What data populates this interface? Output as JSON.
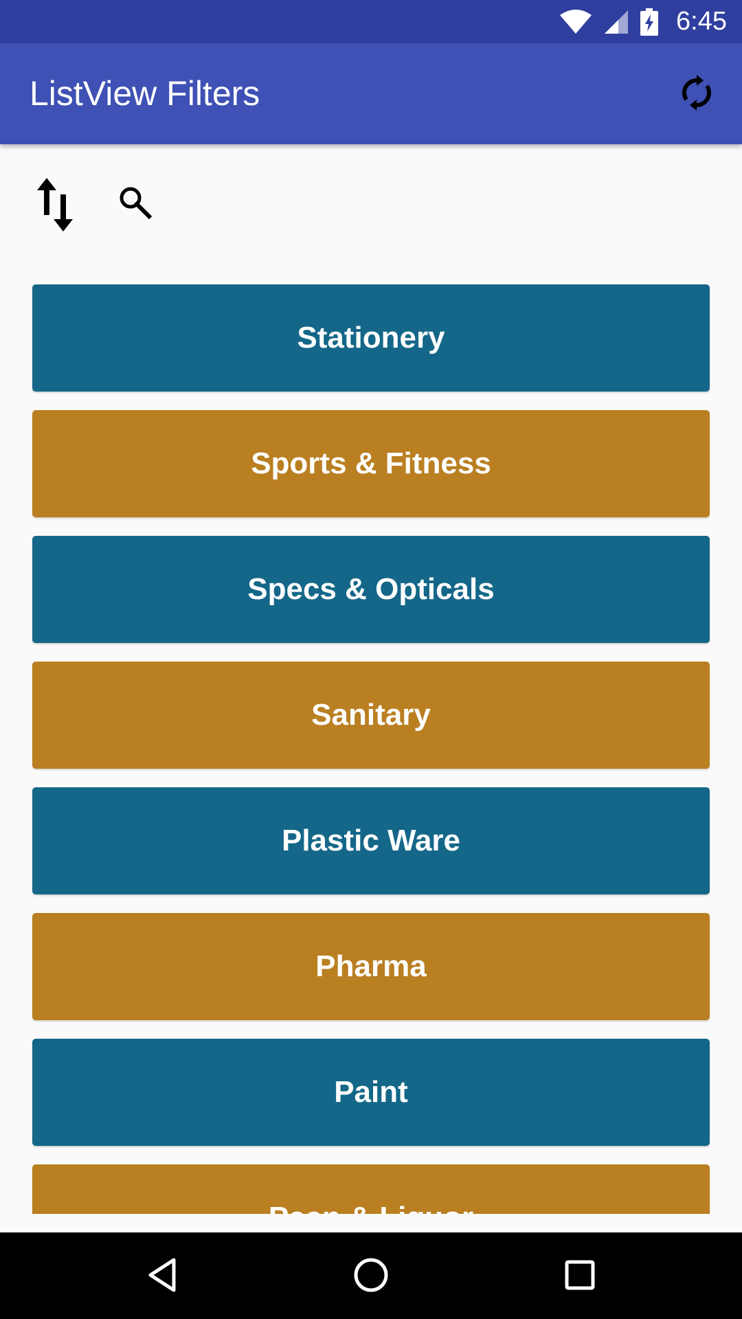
{
  "status_bar": {
    "time": "6:45",
    "icons": [
      "wifi-icon",
      "signal-icon",
      "battery-charging-icon"
    ]
  },
  "app_bar": {
    "title": "ListView Filters",
    "action_icon": "refresh-icon"
  },
  "toolbar": {
    "sort_icon": "sort-icon",
    "search_icon": "search-icon"
  },
  "categories": [
    {
      "label": "Stationery",
      "color": "#146788"
    },
    {
      "label": "Sports & Fitness",
      "color": "#b97f21"
    },
    {
      "label": "Specs & Opticals",
      "color": "#146788"
    },
    {
      "label": "Sanitary",
      "color": "#b97f21"
    },
    {
      "label": "Plastic Ware",
      "color": "#146788"
    },
    {
      "label": "Pharma",
      "color": "#b97f21"
    },
    {
      "label": "Paint",
      "color": "#146788"
    },
    {
      "label": "Paan & Liquor",
      "color": "#b97f21"
    }
  ],
  "colors": {
    "status_bar": "#303f9f",
    "app_bar": "#3f51b5",
    "teal": "#146788",
    "mustard": "#b97f21"
  },
  "nav_bar": {
    "icons": [
      "back-icon",
      "home-icon",
      "recents-icon"
    ]
  }
}
